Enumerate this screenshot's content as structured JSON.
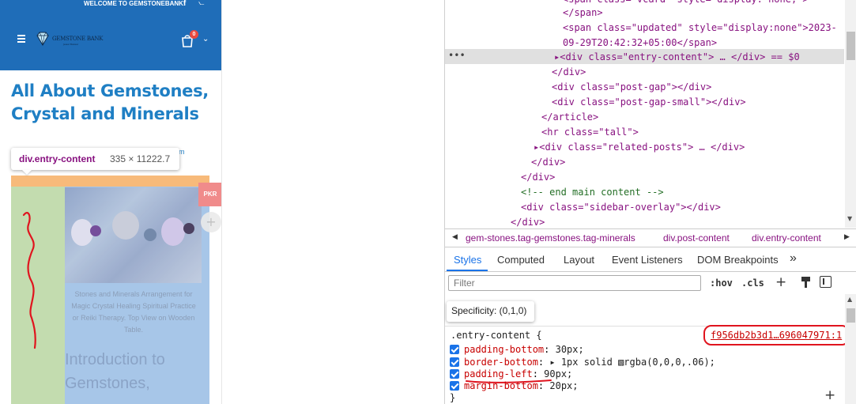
{
  "page": {
    "welcome_text": "WELCOME TO GEMSTONEBANK!",
    "facebook_icon": "facebook-icon",
    "rss_icon": "rss-icon",
    "logo_text": "GEMSTONE BANK",
    "logo_subtext": "Jewel Bazaar",
    "cart_count": "0",
    "post_title": "All About Gemstones, Crystal and Minerals",
    "behind_text_1": "m",
    "behind_text_2": "",
    "image_caption": "Stones and Minerals Arrangement for Magic Crystal Healing Spiritual Practice or Reiki Therapy. Top View on Wooden Table.",
    "intro_heading": "Introduction to Gemstones,",
    "currency_badge": "PKR",
    "add_icon": "+"
  },
  "inspector_tooltip": {
    "tag": "div.entry-content",
    "size": "335 × 11222.7"
  },
  "colors": {
    "header_blue": "#1f6db8",
    "title_blue": "#1f7fc4",
    "margin_overlay": "#f6b26b",
    "padding_overlay": "#c3dcaf",
    "content_overlay": "#a7c6e8",
    "annotation_red": "#e0141e",
    "devtools_accent": "#1a73e8"
  },
  "dom": {
    "lines": [
      "<span class=\"vcard\" style=\"display: none;\">",
      "</span>",
      "<span class=\"updated\" style=\"display:none\">2023-",
      "09-29T20:42:32+05:00</span>",
      "<div class=\"entry-content\"> … </div> == $0",
      "</div>",
      "<div class=\"post-gap\"></div>",
      "<div class=\"post-gap-small\"></div>",
      "</article>",
      "<hr class=\"tall\">",
      "<div class=\"related-posts\"> … </div>",
      "</div>",
      "</div>",
      "<!-- end main content -->",
      "<div class=\"sidebar-overlay\"></div>",
      "</div>"
    ],
    "selected_dots": "•••"
  },
  "breadcrumb": {
    "items": [
      "gem-stones.tag-gemstones.tag-minerals",
      "div.post-content",
      "div.entry-content"
    ]
  },
  "tabs": [
    "Styles",
    "Computed",
    "Layout",
    "Event Listeners",
    "DOM Breakpoints",
    "»"
  ],
  "filter": {
    "placeholder": "Filter",
    "hov": ":hov",
    "cls": ".cls",
    "plus": "+"
  },
  "styles": {
    "specificity_tooltip": "Specificity: (0,1,0)",
    "selector": ".entry-content {",
    "source": "f956db2b3d1…696047971:1",
    "declarations": [
      {
        "name": "padding-bottom",
        "value": "30px;"
      },
      {
        "name": "border-bottom",
        "value": "▸ 1px solid ▧rgba(0,0,0,.06);"
      },
      {
        "name": "padding-left",
        "value": "90px;"
      },
      {
        "name": "margin-bottom",
        "value": "20px;"
      }
    ],
    "close": "}",
    "add": "+"
  }
}
